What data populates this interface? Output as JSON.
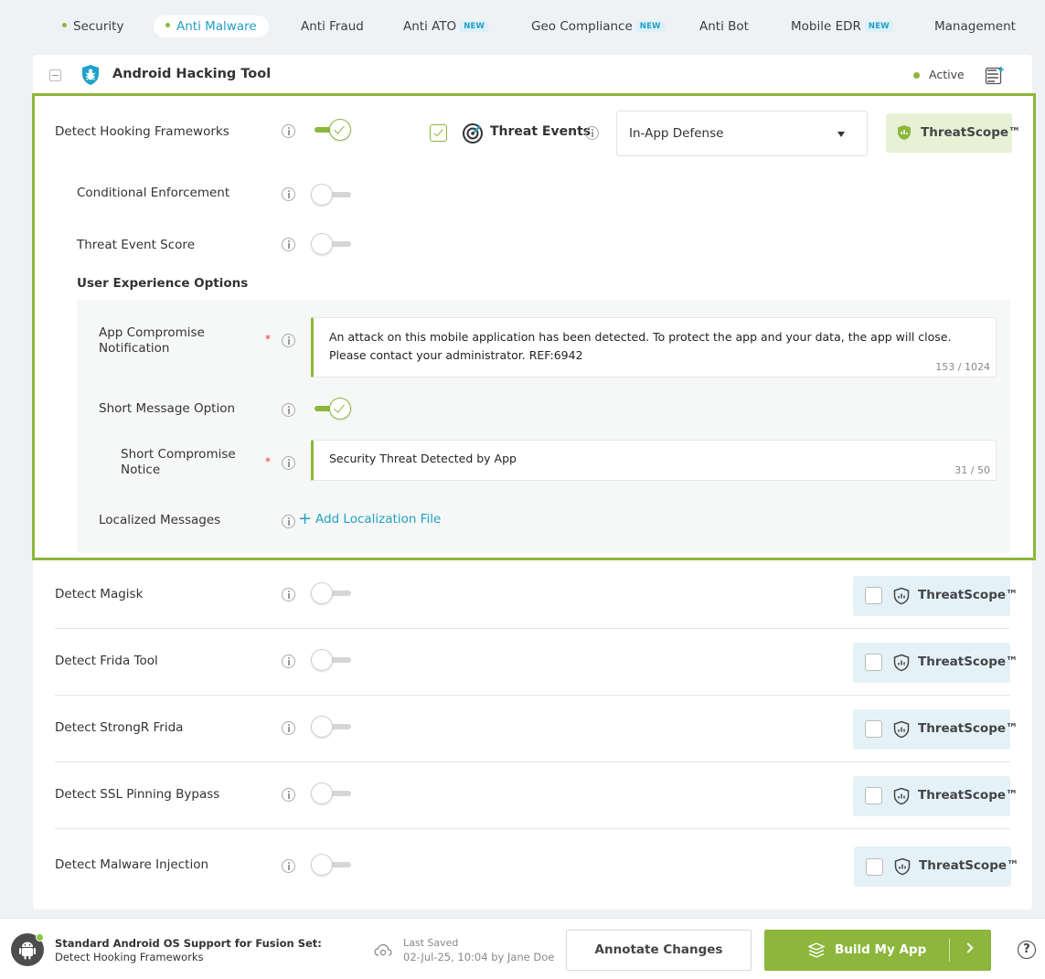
{
  "tabs": [
    {
      "label": "Security",
      "dot": true,
      "active": false,
      "new": false
    },
    {
      "label": "Anti Malware",
      "dot": true,
      "active": true,
      "new": false
    },
    {
      "label": "Anti Fraud",
      "dot": false,
      "active": false,
      "new": false
    },
    {
      "label": "Anti ATO",
      "dot": false,
      "active": false,
      "new": true
    },
    {
      "label": "Geo Compliance",
      "dot": false,
      "active": false,
      "new": true
    },
    {
      "label": "Anti Bot",
      "dot": false,
      "active": false,
      "new": false
    },
    {
      "label": "Mobile EDR",
      "dot": false,
      "active": false,
      "new": true
    },
    {
      "label": "Management",
      "dot": false,
      "active": false,
      "new": false
    }
  ],
  "new_badge": "NEW",
  "card": {
    "title": "Android Hacking Tool",
    "status": "Active"
  },
  "hooking": {
    "label": "Detect Hooking Frameworks",
    "enabled": true,
    "threat_events_label": "Threat Events",
    "threat_events_checked": true,
    "defense_select": "In-App Defense",
    "threatscope": "ThreatScope™"
  },
  "conditional": {
    "label": "Conditional Enforcement",
    "enabled": false
  },
  "score": {
    "label": "Threat Event Score",
    "enabled": false
  },
  "ux_heading": "User Experience Options",
  "compromise": {
    "label_line1": "App Compromise",
    "label_line2": "Notification",
    "text_line1": "An attack on this mobile application has been detected. To protect the app and your data, the app will close.",
    "text_line2": "Please contact your administrator. REF:6942",
    "count": "153 / 1024"
  },
  "short_msg": {
    "label": "Short Message Option",
    "enabled": true
  },
  "short_notice": {
    "label_line1": "Short Compromise",
    "label_line2": "Notice",
    "text": "Security Threat Detected by App",
    "count": "31 / 50"
  },
  "localized": {
    "label": "Localized Messages",
    "add_label": "Add Localization File",
    "plus": "+"
  },
  "required_mark": "*",
  "detections": [
    {
      "label": "Detect Magisk",
      "threatscope": "ThreatScope™"
    },
    {
      "label": "Detect Frida Tool",
      "threatscope": "ThreatScope™"
    },
    {
      "label": "Detect StrongR Frida",
      "threatscope": "ThreatScope™"
    },
    {
      "label": "Detect SSL Pinning Bypass",
      "threatscope": "ThreatScope™"
    },
    {
      "label": "Detect Malware Injection",
      "threatscope": "ThreatScope™"
    }
  ],
  "footer": {
    "title": "Standard Android OS Support for Fusion Set:",
    "subtitle": "Detect Hooking Frameworks",
    "last_saved_label": "Last Saved",
    "last_saved": "02-Jul-25, 10:04 by Jane Doe",
    "annotate_label": "Annotate Changes",
    "build_label": "Build My App",
    "help": "?"
  },
  "colors": {
    "accent_green": "#8cb63c",
    "accent_blue": "#21a0c4"
  }
}
